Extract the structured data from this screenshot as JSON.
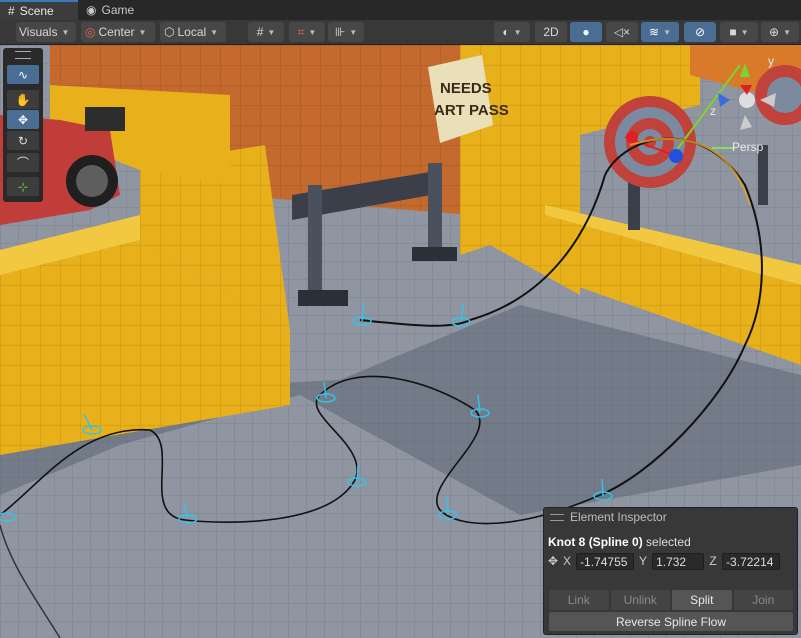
{
  "tabs": [
    {
      "label": "Scene",
      "icon": "grid-icon",
      "active": true
    },
    {
      "label": "Game",
      "icon": "gamepad-icon",
      "active": false
    }
  ],
  "toolbar": {
    "visuals": "Visuals",
    "pivot": "Center",
    "space": "Local",
    "mode_2d": "2D"
  },
  "scene": {
    "sign_text_line1": "NEEDS",
    "sign_text_line2": "ART PASS",
    "persp_label": "Persp",
    "gizmo_axis_y": "y",
    "gizmo_axis_z": "z"
  },
  "inspector": {
    "title": "Element Inspector",
    "selection_knot": "Knot 8",
    "selection_spline": "(Spline 0)",
    "selection_suffix": "selected",
    "position": {
      "x_label": "X",
      "x": "-1.74755",
      "y_label": "Y",
      "y": "1.732",
      "z_label": "Z",
      "z": "-3.72214"
    },
    "buttons": [
      "Link",
      "Unlink",
      "Split",
      "Join"
    ],
    "active_button": "Split",
    "reverse": "Reverse Spline Flow"
  },
  "colors": {
    "accent": "#4a6d94",
    "wall": "#e8b11c",
    "floor": "#8d94a0",
    "brick": "#c46a2f",
    "knot": "#36c3e8"
  }
}
